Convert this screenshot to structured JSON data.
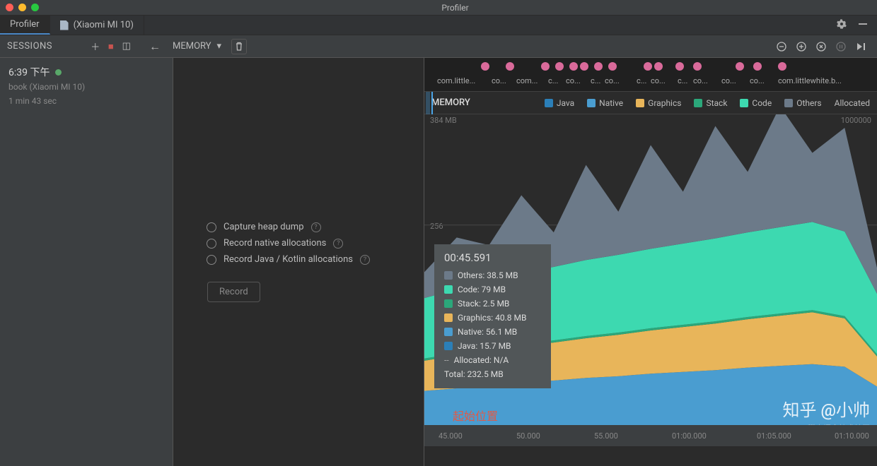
{
  "window": {
    "title": "Profiler"
  },
  "tabs": {
    "profiler": "Profiler",
    "device": "(Xiaomi MI 10)"
  },
  "sessions": {
    "header": "SESSIONS",
    "item": {
      "time": "6:39 下午",
      "name": "book (Xiaomi MI 10)",
      "duration": "1 min 43 sec"
    }
  },
  "toolbar": {
    "dropdown": "MEMORY"
  },
  "capture": {
    "opt1": "Capture heap dump",
    "opt2": "Record native allocations",
    "opt3": "Record Java / Kotlin allocations",
    "record": "Record"
  },
  "chart_header": {
    "title": "MEMORY",
    "legend": [
      "Java",
      "Native",
      "Graphics",
      "Stack",
      "Code",
      "Others",
      "Allocated"
    ],
    "max_label": "384 MB",
    "allocated_max": "1000000"
  },
  "axis": {
    "y256": "256",
    "ticks": [
      "45.000",
      "50.000",
      "55.000",
      "01:00.000",
      "01:05.000",
      "01:10.000"
    ]
  },
  "events": {
    "label_left": "com.little...",
    "label_mid": "co...",
    "label_right": "com.littlewhite.b..."
  },
  "tooltip": {
    "time": "00:45.591",
    "rows": [
      {
        "label": "Others: 38.5 MB",
        "color": "#6c7a89"
      },
      {
        "label": "Code: 79 MB",
        "color": "#3dd9b0"
      },
      {
        "label": "Stack: 2.5 MB",
        "color": "#2ba77a"
      },
      {
        "label": "Graphics: 40.8 MB",
        "color": "#e8b55a"
      },
      {
        "label": "Native: 56.1 MB",
        "color": "#4a9dd0"
      },
      {
        "label": "Java: 15.7 MB",
        "color": "#2b7fb8"
      }
    ],
    "allocated": "Allocated: N/A",
    "total": "Total: 232.5 MB"
  },
  "annotations": {
    "start": "起始位置",
    "watermark": "知乎 @小帅",
    "watermark_sub": "@稀土掘金技术社区"
  },
  "colors": {
    "java": "#2b7fb8",
    "native": "#4a9dd0",
    "graphics": "#e8b55a",
    "stack": "#2ba77a",
    "code": "#3dd9b0",
    "others": "#6c7a89"
  },
  "chart_data": {
    "type": "area",
    "title": "MEMORY",
    "ylabel": "MB",
    "ylim": [
      0,
      384
    ],
    "x_time_seconds": [
      44,
      46,
      48,
      50,
      52,
      54,
      56,
      58,
      60,
      62,
      64,
      66,
      68,
      70,
      72
    ],
    "series": [
      {
        "name": "Java",
        "color": "#2b7fb8",
        "values": [
          14,
          15,
          15.7,
          16,
          16,
          17,
          17,
          18,
          18,
          18,
          19,
          19,
          19,
          18,
          14
        ]
      },
      {
        "name": "Native",
        "color": "#4a9dd0",
        "values": [
          50,
          52,
          56.1,
          58,
          60,
          62,
          64,
          66,
          68,
          70,
          72,
          74,
          76,
          74,
          55
        ]
      },
      {
        "name": "Graphics",
        "color": "#e8b55a",
        "values": [
          35,
          38,
          40.8,
          42,
          44,
          46,
          48,
          50,
          52,
          54,
          56,
          58,
          60,
          56,
          35
        ]
      },
      {
        "name": "Stack",
        "color": "#2ba77a",
        "values": [
          2.5,
          2.5,
          2.5,
          2.5,
          2.5,
          2.5,
          2.5,
          2.5,
          2.5,
          2.5,
          2.5,
          2.5,
          2.5,
          2.5,
          2.5
        ]
      },
      {
        "name": "Code",
        "color": "#3dd9b0",
        "values": [
          70,
          74,
          79,
          82,
          85,
          88,
          90,
          92,
          94,
          96,
          98,
          100,
          102,
          98,
          70
        ]
      },
      {
        "name": "Others",
        "color": "#6c7a89",
        "values": [
          30,
          60,
          38.5,
          90,
          40,
          110,
          50,
          120,
          60,
          130,
          70,
          140,
          80,
          120,
          30
        ]
      }
    ],
    "allocated_ylim": [
      0,
      1000000
    ],
    "allocated_series": {
      "name": "Allocated",
      "values": null
    },
    "time_ticks": [
      "45.000",
      "50.000",
      "55.000",
      "01:00.000",
      "01:05.000",
      "01:10.000"
    ],
    "cursor_time": "00:45.591"
  }
}
